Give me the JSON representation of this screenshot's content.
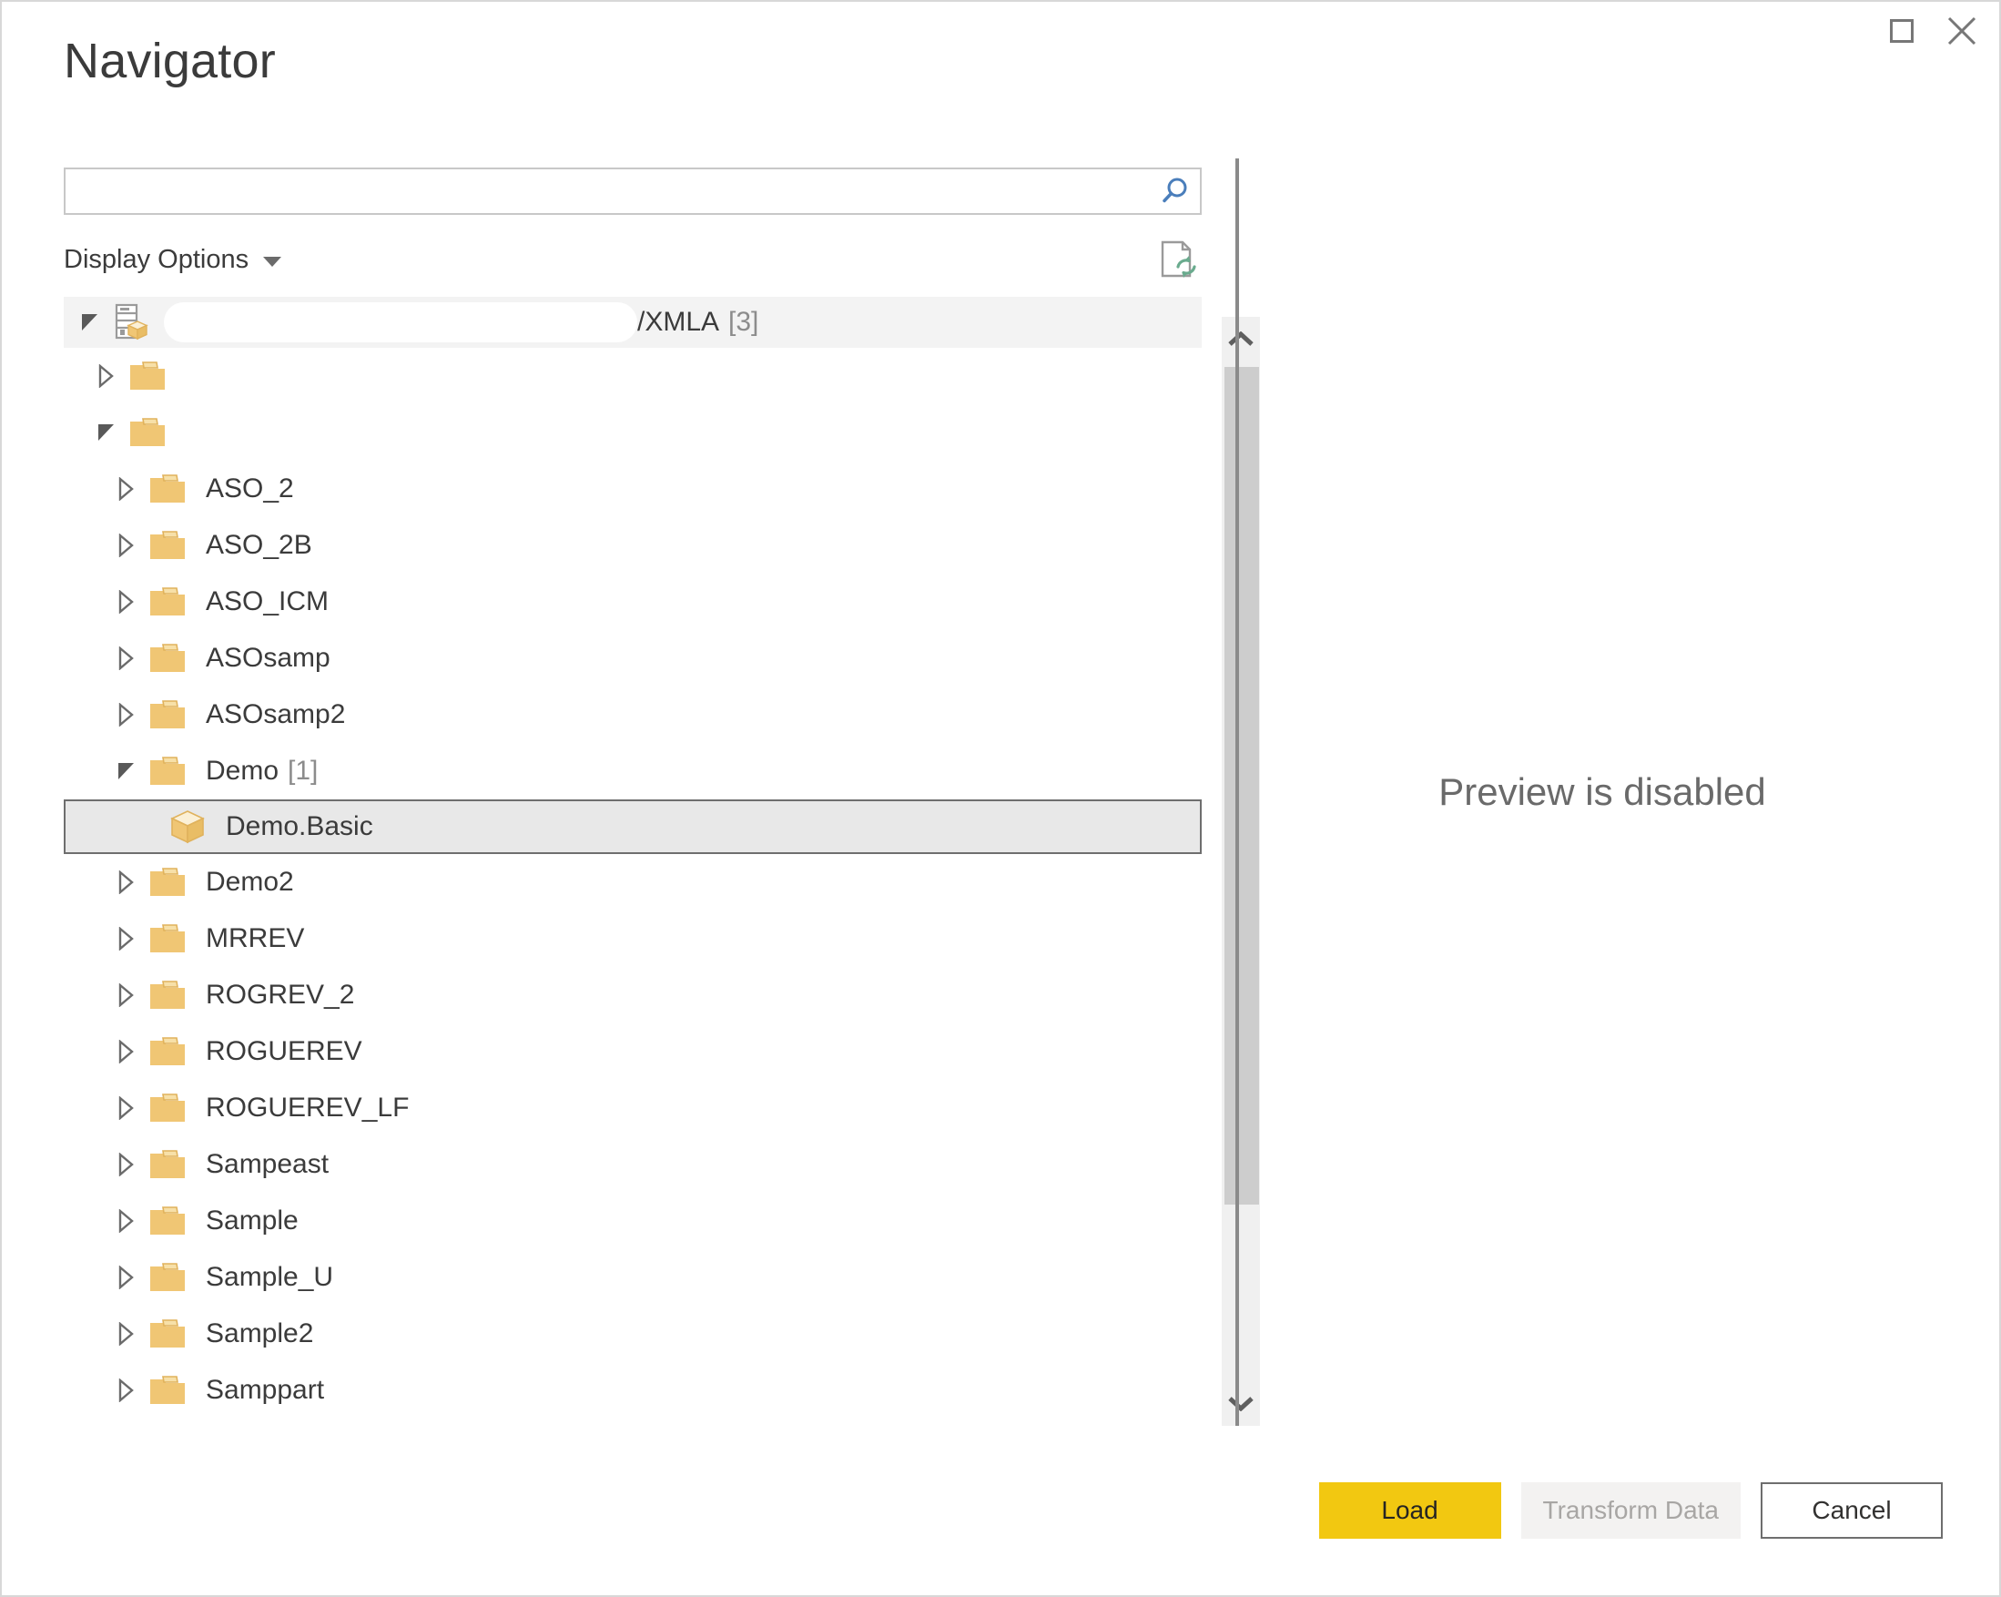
{
  "window": {
    "title": "Navigator",
    "maximize_icon": "maximize-icon",
    "close_icon": "close-icon"
  },
  "search": {
    "value": "",
    "placeholder": "",
    "icon": "search-icon"
  },
  "toolbar": {
    "display_options_label": "Display Options",
    "dropdown_icon": "chevron-down-icon",
    "refresh_icon": "refresh-document-icon"
  },
  "tree": {
    "scroll_up_icon": "chevron-up-icon",
    "scroll_down_icon": "chevron-down-icon",
    "nodes": [
      {
        "label": "",
        "suffix": "/XMLA",
        "count": "[3]",
        "level": 0,
        "state": "expanded",
        "icon": "server-cube-icon",
        "selected": false,
        "redacted": true
      },
      {
        "label": "",
        "suffix": "",
        "count": "",
        "level": 1,
        "state": "collapsed",
        "icon": "folder-icon",
        "selected": false,
        "redacted": false
      },
      {
        "label": "",
        "suffix": "",
        "count": "",
        "level": 1,
        "state": "expanded",
        "icon": "folder-icon",
        "selected": false,
        "redacted": false
      },
      {
        "label": "ASO_2",
        "suffix": "",
        "count": "",
        "level": 2,
        "state": "collapsed",
        "icon": "folder-icon",
        "selected": false,
        "redacted": false
      },
      {
        "label": "ASO_2B",
        "suffix": "",
        "count": "",
        "level": 2,
        "state": "collapsed",
        "icon": "folder-icon",
        "selected": false,
        "redacted": false
      },
      {
        "label": "ASO_ICM",
        "suffix": "",
        "count": "",
        "level": 2,
        "state": "collapsed",
        "icon": "folder-icon",
        "selected": false,
        "redacted": false
      },
      {
        "label": "ASOsamp",
        "suffix": "",
        "count": "",
        "level": 2,
        "state": "collapsed",
        "icon": "folder-icon",
        "selected": false,
        "redacted": false
      },
      {
        "label": "ASOsamp2",
        "suffix": "",
        "count": "",
        "level": 2,
        "state": "collapsed",
        "icon": "folder-icon",
        "selected": false,
        "redacted": false
      },
      {
        "label": "Demo",
        "suffix": "",
        "count": "[1]",
        "level": 2,
        "state": "expanded",
        "icon": "folder-icon",
        "selected": false,
        "redacted": false
      },
      {
        "label": "Demo.Basic",
        "suffix": "",
        "count": "",
        "level": 3,
        "state": "leaf",
        "icon": "cube-icon",
        "selected": true,
        "redacted": false
      },
      {
        "label": "Demo2",
        "suffix": "",
        "count": "",
        "level": 2,
        "state": "collapsed",
        "icon": "folder-icon",
        "selected": false,
        "redacted": false
      },
      {
        "label": "MRREV",
        "suffix": "",
        "count": "",
        "level": 2,
        "state": "collapsed",
        "icon": "folder-icon",
        "selected": false,
        "redacted": false
      },
      {
        "label": "ROGREV_2",
        "suffix": "",
        "count": "",
        "level": 2,
        "state": "collapsed",
        "icon": "folder-icon",
        "selected": false,
        "redacted": false
      },
      {
        "label": "ROGUEREV",
        "suffix": "",
        "count": "",
        "level": 2,
        "state": "collapsed",
        "icon": "folder-icon",
        "selected": false,
        "redacted": false
      },
      {
        "label": "ROGUEREV_LF",
        "suffix": "",
        "count": "",
        "level": 2,
        "state": "collapsed",
        "icon": "folder-icon",
        "selected": false,
        "redacted": false
      },
      {
        "label": "Sampeast",
        "suffix": "",
        "count": "",
        "level": 2,
        "state": "collapsed",
        "icon": "folder-icon",
        "selected": false,
        "redacted": false
      },
      {
        "label": "Sample",
        "suffix": "",
        "count": "",
        "level": 2,
        "state": "collapsed",
        "icon": "folder-icon",
        "selected": false,
        "redacted": false
      },
      {
        "label": "Sample_U",
        "suffix": "",
        "count": "",
        "level": 2,
        "state": "collapsed",
        "icon": "folder-icon",
        "selected": false,
        "redacted": false
      },
      {
        "label": "Sample2",
        "suffix": "",
        "count": "",
        "level": 2,
        "state": "collapsed",
        "icon": "folder-icon",
        "selected": false,
        "redacted": false
      },
      {
        "label": "Samppart",
        "suffix": "",
        "count": "",
        "level": 2,
        "state": "collapsed",
        "icon": "folder-icon",
        "selected": false,
        "redacted": false
      }
    ]
  },
  "preview": {
    "message": "Preview is disabled"
  },
  "footer": {
    "load_label": "Load",
    "transform_label": "Transform Data",
    "cancel_label": "Cancel"
  },
  "colors": {
    "accent_yellow": "#f2c811",
    "folder_yellow": "#f0c674",
    "search_blue": "#4a7ebb",
    "refresh_green": "#6aab8e",
    "text": "#3b3b3b",
    "muted_text": "#8c8c8c",
    "selection_bg": "#e8e8e8",
    "selection_border": "#6e6e6e",
    "scrollbar_thumb": "#cdcdcd",
    "scrollbar_track": "#f0f0f0"
  }
}
